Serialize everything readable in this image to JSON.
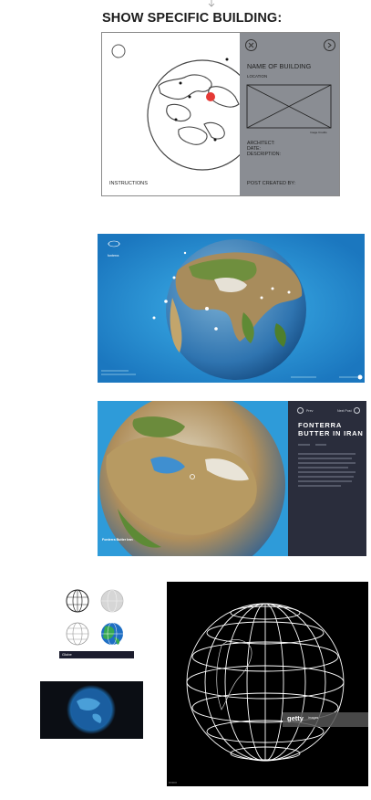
{
  "heading": "SHOW SPECIFIC BUILDING:",
  "wireframe": {
    "name_label": "NAME OF BUILDING",
    "location_label": "LOCATION",
    "image_caption": "Image Credits",
    "architect_label": "ARCHITECT:",
    "date_label": "DATE:",
    "description_label": "DESCRIPTION:",
    "instructions": "INSTRUCTIONS",
    "post_created_by": "POST CREATED BY:",
    "close_icon": "close-icon",
    "next_icon": "chevron-right-icon"
  },
  "screen1": {
    "logo_text": "fonterra"
  },
  "screen2": {
    "prev_label": "Prev",
    "next_label": "Next Post",
    "title_line1": "FONTERRA",
    "title_line2": "BUTTER IN IRAN",
    "footer_title": "Fonterra Butter Iran"
  },
  "icons_strip_label": "Globe",
  "getty": {
    "brand": "getty",
    "sub": "images"
  },
  "colors": {
    "ocean": "#2d9ad8",
    "panel_dark": "#2a2d3c",
    "wire_gray": "#8a8d93",
    "red_marker": "#e53935"
  }
}
